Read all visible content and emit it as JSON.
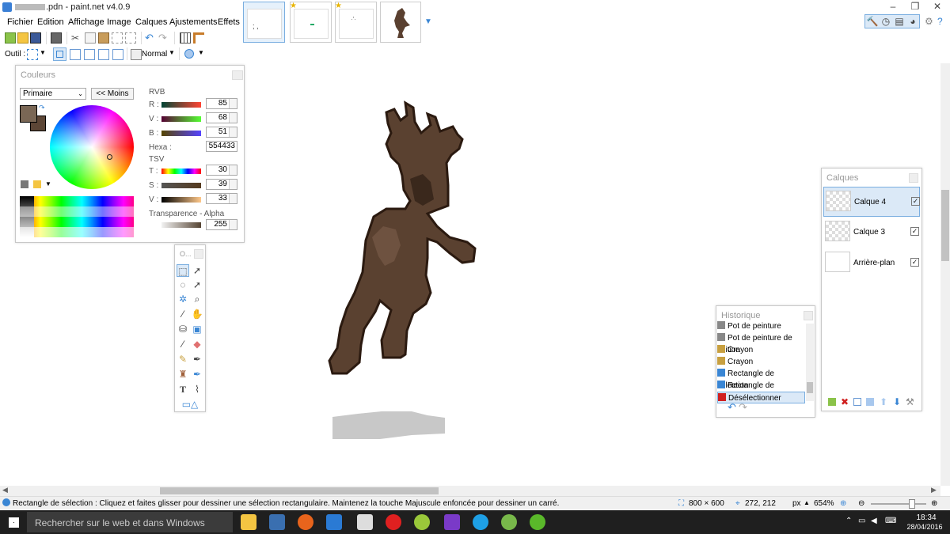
{
  "window": {
    "title": "paint.net v4.0.9",
    "file_ext": ".pdn"
  },
  "menu": [
    "Fichier",
    "Edition",
    "Affichage",
    "Image",
    "Calques",
    "Ajustements",
    "Effets"
  ],
  "toolbar": {
    "outil_label": "Outil :",
    "blend_mode": "Normal"
  },
  "colors_panel": {
    "title": "Couleurs",
    "primary_select": "Primaire",
    "less_button": "<< Moins",
    "rvb_label": "RVB",
    "r_label": "R :",
    "g_label": "V :",
    "b_label": "B :",
    "r": "85",
    "g": "68",
    "b": "51",
    "hex_label": "Hexa :",
    "hex": "554433",
    "tsv_label": "TSV",
    "t_label": "T :",
    "s_label": "S :",
    "v_label": "V :",
    "t": "30",
    "s": "39",
    "v": "33",
    "alpha_label": "Transparence - Alpha",
    "alpha": "255",
    "primary_color": "#7a6755",
    "secondary_color": "#5c4636"
  },
  "tools_panel": {
    "title": "O..."
  },
  "history_panel": {
    "title": "Historique",
    "items": [
      {
        "label": "Pot de peinture",
        "icon": "paint-bucket-icon"
      },
      {
        "label": "Pot de peinture de finition",
        "icon": "paint-bucket-icon"
      },
      {
        "label": "Crayon",
        "icon": "pencil-icon"
      },
      {
        "label": "Crayon",
        "icon": "pencil-icon"
      },
      {
        "label": "Rectangle de sélection",
        "icon": "rect-select-icon"
      },
      {
        "label": "Rectangle de sélection",
        "icon": "rect-select-icon"
      },
      {
        "label": "Désélectionner",
        "icon": "deselect-icon"
      }
    ]
  },
  "layers_panel": {
    "title": "Calques",
    "layers": [
      {
        "name": "Calque 4",
        "checked": true,
        "selected": true
      },
      {
        "name": "Calque 3",
        "checked": true,
        "selected": false
      },
      {
        "name": "Arrière-plan",
        "checked": true,
        "selected": false
      }
    ]
  },
  "status": {
    "hint": "Rectangle de sélection : Cliquez et faites glisser pour dessiner une sélection rectangulaire. Maintenez la touche Majuscule enfoncée pour dessiner un carré.",
    "size": "800 × 600",
    "cursor": "272, 212",
    "unit": "px",
    "zoom": "654%"
  },
  "taskbar": {
    "search": "Rechercher sur le web et dans Windows",
    "time": "18:34",
    "date": "28/04/2016"
  },
  "accent": "#3399ff"
}
